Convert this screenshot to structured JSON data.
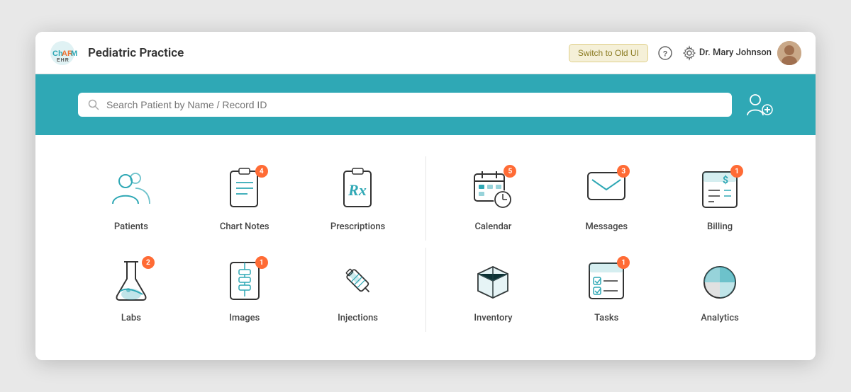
{
  "header": {
    "brand": "ChARM",
    "brand_sub": "EHR",
    "practice": "Pediatric Practice",
    "switch_btn": "Switch to Old UI",
    "user_name": "Dr. Mary Johnson"
  },
  "search": {
    "placeholder": "Search Patient by Name / Record ID"
  },
  "menu": {
    "left_items": [
      {
        "id": "patients",
        "label": "Patients",
        "badge": null
      },
      {
        "id": "chart-notes",
        "label": "Chart Notes",
        "badge": "4"
      },
      {
        "id": "prescriptions",
        "label": "Prescriptions",
        "badge": null
      }
    ],
    "right_items": [
      {
        "id": "calendar",
        "label": "Calendar",
        "badge": "5"
      },
      {
        "id": "messages",
        "label": "Messages",
        "badge": "3"
      },
      {
        "id": "billing",
        "label": "Billing",
        "badge": "1"
      }
    ],
    "left_items2": [
      {
        "id": "labs",
        "label": "Labs",
        "badge": "2"
      },
      {
        "id": "images",
        "label": "Images",
        "badge": "1"
      },
      {
        "id": "injections",
        "label": "Injections",
        "badge": null
      }
    ],
    "right_items2": [
      {
        "id": "inventory",
        "label": "Inventory",
        "badge": null
      },
      {
        "id": "tasks",
        "label": "Tasks",
        "badge": "1"
      },
      {
        "id": "analytics",
        "label": "Analytics",
        "badge": null
      }
    ]
  }
}
